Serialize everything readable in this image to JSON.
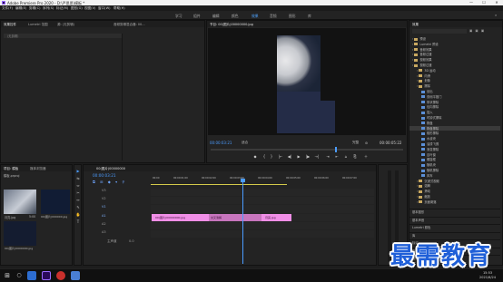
{
  "window": {
    "title": "Adobe Premiere Pro 2020 - D:\\严思思\\模板 *",
    "controls": [
      "—",
      "☐",
      "✕"
    ]
  },
  "menu": [
    "文件(F)",
    "编辑(E)",
    "剪辑(C)",
    "序列(S)",
    "标记(M)",
    "图形(G)",
    "视图(V)",
    "窗口(W)",
    "帮助(H)"
  ],
  "workspaces": [
    "学习",
    "组件",
    "编辑",
    "颜色",
    "效果",
    "音频",
    "图形",
    "库"
  ],
  "workspace_active_index": 3,
  "source_panel": {
    "tabs": [
      "效果控件",
      "Lumetri 范围",
      "源: (无剪辑)",
      "音频剪辑混合器: 00..."
    ],
    "field": "（无剪辑）"
  },
  "program_monitor": {
    "tab": "节目: 00(图片)00000000.jpg",
    "timecode_left": "00:00:03:21",
    "fit": "适合",
    "quality": "完整",
    "timecode_right": "00:00:05:22"
  },
  "transport": [
    "◆",
    "{",
    "}",
    "|←",
    "◀|",
    "▶",
    "|▶",
    "→|",
    "⇥",
    "⇤",
    "⌂",
    "⎘",
    "＋"
  ],
  "project_panel": {
    "tabs": [
      "项目: 模板",
      "媒体浏览器"
    ],
    "file": "模板.prproj",
    "items": [
      {
        "name": "月亮.jpg",
        "duration": "5:00"
      },
      {
        "name": "00(图片)000000.jpg",
        "duration": "5:00"
      },
      {
        "name": "00(图片)0000000.jpg",
        "duration": ""
      }
    ]
  },
  "tools": [
    "▶",
    "⇆",
    "⇔",
    "✂",
    "↔",
    "✎",
    "✋",
    "T"
  ],
  "timeline": {
    "tab": "00(图片)00000000",
    "timecode": "00:00:03:21",
    "ruler": [
      "00:00",
      "00:00:01:00",
      "00:00:02:00",
      "00:00:03:00",
      "00:00:04:00",
      "00:00:05:00",
      "00:00:06:00",
      "00:00:07:00",
      "00:00:08:00"
    ],
    "tracks": [
      "V3",
      "V2",
      "V1",
      "A1",
      "A2",
      "A3",
      "主声道"
    ],
    "master_value": "0.0",
    "clips": [
      {
        "label": "00(图片)00000000.jpg"
      },
      {
        "label": "交叉溶解"
      },
      {
        "label": "月亮.jpg"
      }
    ]
  },
  "effects_panel": {
    "tab": "效果",
    "items": [
      {
        "label": "预设",
        "indent": 0,
        "folder": true
      },
      {
        "label": "Lumetri 预设",
        "indent": 0,
        "folder": true
      },
      {
        "label": "音频效果",
        "indent": 0,
        "folder": true
      },
      {
        "label": "音频过渡",
        "indent": 0,
        "folder": true
      },
      {
        "label": "视频效果",
        "indent": 0,
        "folder": true
      },
      {
        "label": "视频过渡",
        "indent": 0,
        "folder": true
      },
      {
        "label": "3D 运动",
        "indent": 1,
        "folder": true
      },
      {
        "label": "内滑",
        "indent": 1,
        "folder": true
      },
      {
        "label": "划像",
        "indent": 1,
        "folder": true
      },
      {
        "label": "擦除",
        "indent": 1,
        "folder": true
      },
      {
        "label": "划出",
        "indent": 2,
        "folder": false
      },
      {
        "label": "双侧平推门",
        "indent": 2,
        "folder": false
      },
      {
        "label": "带状擦除",
        "indent": 2,
        "folder": false
      },
      {
        "label": "径向擦除",
        "indent": 2,
        "folder": false
      },
      {
        "label": "插入",
        "indent": 2,
        "folder": false
      },
      {
        "label": "时钟式擦除",
        "indent": 2,
        "folder": false
      },
      {
        "label": "棋盘",
        "indent": 2,
        "folder": false
      },
      {
        "label": "棋盘擦除",
        "indent": 2,
        "folder": false
      },
      {
        "label": "楔形擦除",
        "indent": 2,
        "folder": false
      },
      {
        "label": "水波块",
        "indent": 2,
        "folder": false
      },
      {
        "label": "油漆飞溅",
        "indent": 2,
        "folder": false
      },
      {
        "label": "渐变擦除",
        "indent": 2,
        "folder": false
      },
      {
        "label": "百叶窗",
        "indent": 2,
        "folder": false
      },
      {
        "label": "螺旋框",
        "indent": 2,
        "folder": false
      },
      {
        "label": "随机块",
        "indent": 2,
        "folder": false
      },
      {
        "label": "随机擦除",
        "indent": 2,
        "folder": false
      },
      {
        "label": "风车",
        "indent": 2,
        "folder": false
      },
      {
        "label": "沉浸式视频",
        "indent": 1,
        "folder": true
      },
      {
        "label": "溶解",
        "indent": 1,
        "folder": true
      },
      {
        "label": "滑动",
        "indent": 1,
        "folder": true
      },
      {
        "label": "缩放",
        "indent": 1,
        "folder": true
      },
      {
        "label": "页面剥落",
        "indent": 1,
        "folder": true
      }
    ],
    "selected_index": 17,
    "bottom_panels": [
      "基本图形",
      "基本声音",
      "Lumetri 颜色",
      "库",
      "标记",
      "历史记录",
      "信息"
    ]
  },
  "taskbar": {
    "time": "15:53",
    "date": "2021/6/24"
  },
  "watermark": "最需教育",
  "colors": {
    "accent": "#4b9cff",
    "clip_pink": "#f08ee6",
    "playhead": "#4b9cff",
    "watermark": "#1f5fd8"
  }
}
